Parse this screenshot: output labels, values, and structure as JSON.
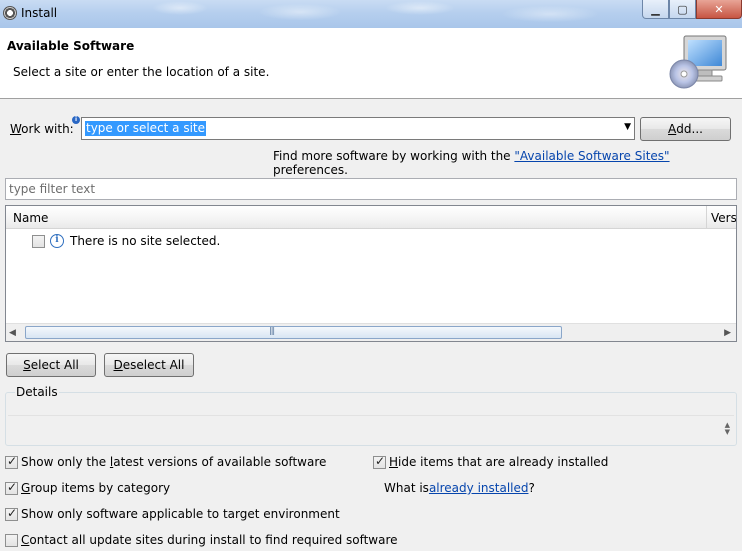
{
  "window": {
    "title": "Install",
    "controls": {
      "minimize": "▁",
      "maximize": "▢",
      "close": "✕"
    }
  },
  "banner": {
    "title": "Available Software",
    "description": "Select a site or enter the location of a site."
  },
  "work_with": {
    "label_prefix": "",
    "label_accel": "W",
    "label_rest": "ork with:",
    "value": "type or select a site",
    "add_label_accel": "A",
    "add_label_rest": "dd...",
    "more_prefix": "Find more software by working with the ",
    "more_link": "\"Available Software Sites\"",
    "more_suffix": " preferences."
  },
  "filter": {
    "placeholder": "type filter text"
  },
  "tree": {
    "columns": [
      "Name",
      "Vers"
    ],
    "rows": [
      {
        "checked": false,
        "text": "There is no site selected."
      }
    ]
  },
  "buttons": {
    "select_all_accel": "S",
    "select_all_rest": "elect All",
    "deselect_all_accel": "D",
    "deselect_all_rest": "eselect All"
  },
  "details": {
    "legend": "Details"
  },
  "options": {
    "latest": {
      "checked": true,
      "pre": "Show only the ",
      "accel": "l",
      "post": "atest versions of available software"
    },
    "hide": {
      "checked": true,
      "pre": "",
      "accel": "H",
      "post": "ide items that are already installed"
    },
    "group": {
      "checked": true,
      "pre": "",
      "accel": "G",
      "post": "roup items by category"
    },
    "what_is_prefix": "What is ",
    "what_is_link": "already installed",
    "what_is_suffix": "?",
    "applicable": {
      "checked": true,
      "pre": "Show only software applicable to target environment",
      "accel": "",
      "post": ""
    },
    "contact": {
      "checked": false,
      "pre": "",
      "accel": "C",
      "post": "ontact all update sites during install to find required software"
    }
  },
  "colors": {
    "link": "#0645ad",
    "selection": "#3399ff"
  }
}
